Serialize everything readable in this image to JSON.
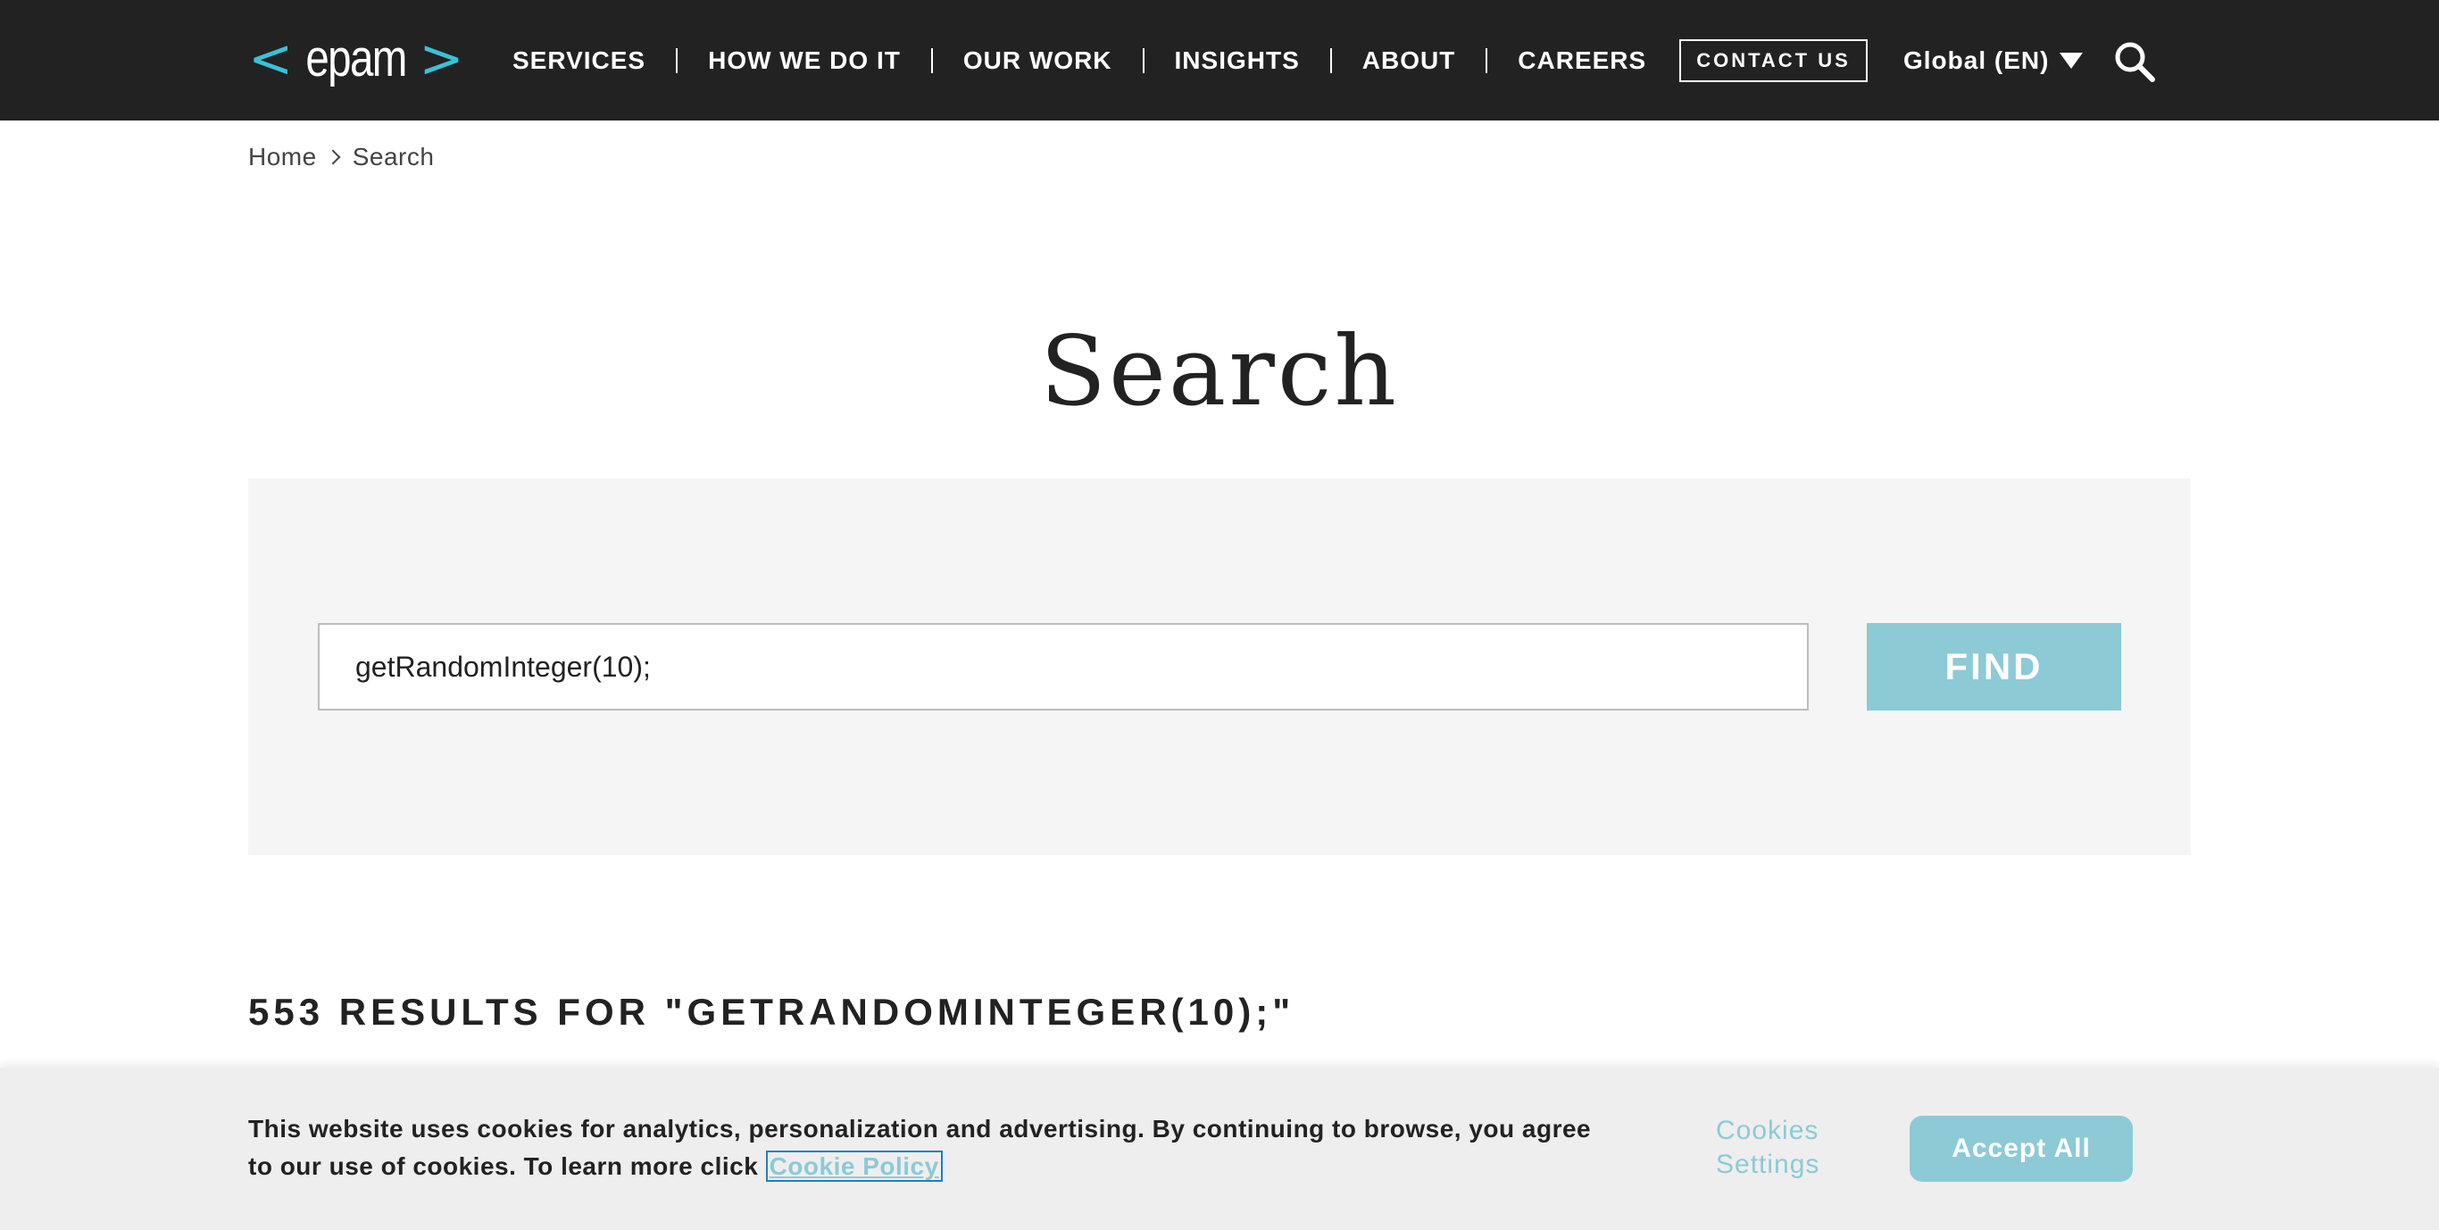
{
  "header": {
    "logo": {
      "left": "<",
      "word": "epam",
      "right": ">"
    },
    "nav": [
      {
        "label": "SERVICES"
      },
      {
        "label": "HOW WE DO IT"
      },
      {
        "label": "OUR WORK"
      },
      {
        "label": "INSIGHTS"
      },
      {
        "label": "ABOUT"
      },
      {
        "label": "CAREERS"
      }
    ],
    "contact_label": "CONTACT US",
    "language_label": "Global (EN)",
    "icons": {
      "language": "caret-down-icon",
      "search": "search-icon"
    }
  },
  "breadcrumb": {
    "home": "Home",
    "current": "Search",
    "separator_icon": "chevron-right-icon"
  },
  "page_title": "Search",
  "search": {
    "value": "getRandomInteger(10);",
    "button_label": "FIND"
  },
  "results_heading": "553 RESULTS FOR \"GETRANDOMINTEGER(10);\"",
  "cookie_banner": {
    "text": "This website uses cookies for analytics, personalization and advertising. By continuing to browse, you agree to our use of cookies. To learn more click",
    "link_label": "Cookie Policy",
    "settings_label": "Cookies Settings",
    "accept_label": "Accept All"
  },
  "colors": {
    "header_bg": "#222222",
    "accent": "#39c2d7",
    "button": "#8ccad6",
    "panel_bg": "#f5f5f5",
    "banner_bg": "#eeeeee"
  }
}
